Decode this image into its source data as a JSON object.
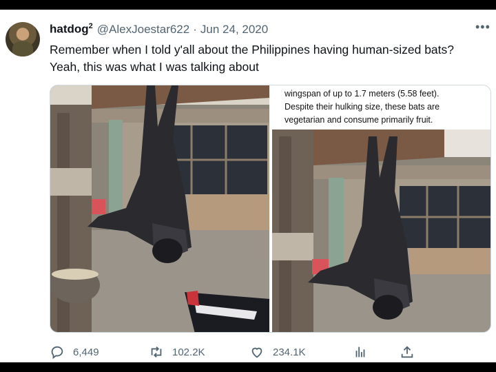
{
  "tweet": {
    "display_name": "hatdog",
    "name_superscript": "2",
    "handle": "@AlexJoestar622",
    "separator": "·",
    "date": "Jun 24, 2020",
    "text": "Remember when I told y'all about the Philippines having human-sized bats? Yeah, this was what I was talking about"
  },
  "media": {
    "caption_lines": [
      "wingspan of up to 1.7 meters (5.58 feet).",
      "Despite their hulking size, these bats are",
      "vegetarian and consume primarily fruit."
    ]
  },
  "actions": {
    "replies": "6,449",
    "retweets": "102.2K",
    "likes": "234.1K"
  },
  "icons": {
    "more": "more-icon",
    "reply": "reply-icon",
    "retweet": "retweet-icon",
    "like": "heart-icon",
    "views": "views-icon",
    "share": "share-icon"
  },
  "colors": {
    "text_primary": "#0f1419",
    "text_secondary": "#536471",
    "border": "#cfd9de"
  }
}
